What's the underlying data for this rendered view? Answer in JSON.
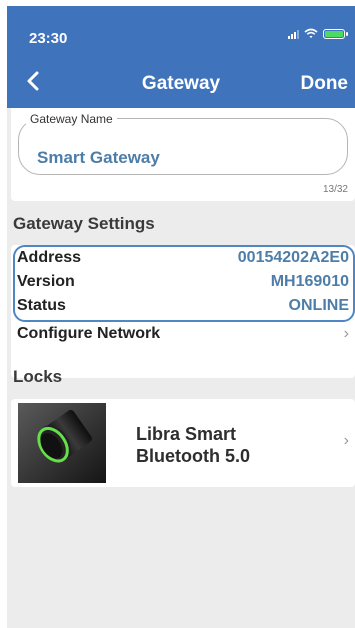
{
  "status_bar": {
    "time": "23:30"
  },
  "header": {
    "title": "Gateway",
    "done_label": "Done",
    "back_icon": "chevron-left-icon"
  },
  "gateway_name": {
    "legend": "Gateway Name",
    "value": "Smart Gateway",
    "counter": "13/32"
  },
  "settings": {
    "title": "Gateway Settings",
    "rows": [
      {
        "label": "Address",
        "value": "00154202A2E0"
      },
      {
        "label": "Version",
        "value": "MH169010"
      },
      {
        "label": "Status",
        "value": "ONLINE"
      }
    ],
    "configure_label": "Configure Network"
  },
  "locks": {
    "title": "Locks",
    "items": [
      {
        "name_line1": "Libra Smart",
        "name_line2": "Bluetooth 5.0"
      }
    ]
  },
  "colors": {
    "header": "#3f74bd",
    "accent": "#4e7da8",
    "background": "#ececec"
  }
}
